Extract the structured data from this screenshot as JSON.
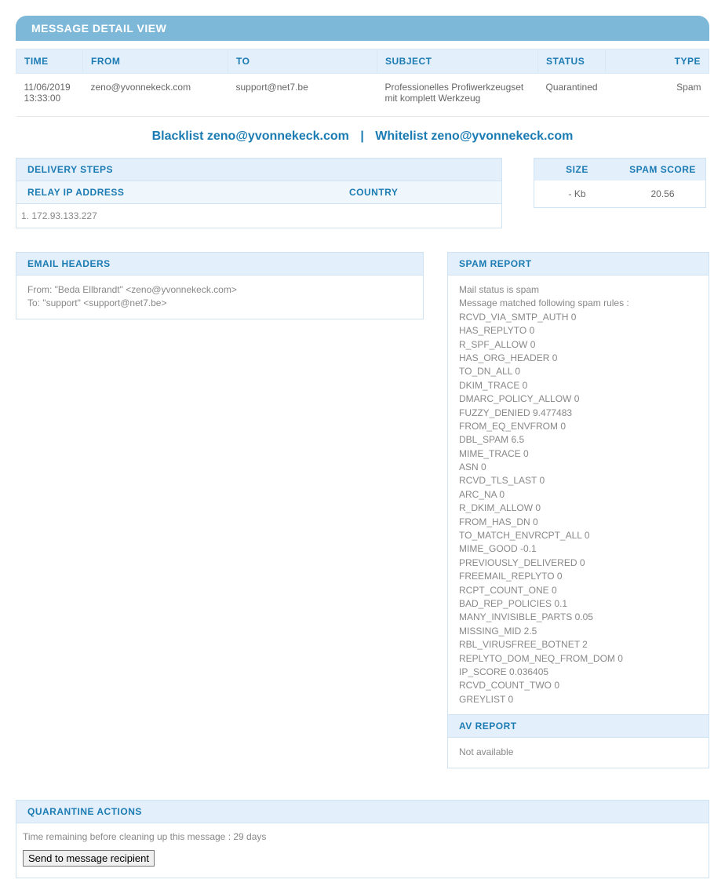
{
  "title": "MESSAGE DETAIL VIEW",
  "table": {
    "headers": {
      "time": "TIME",
      "from": "FROM",
      "to": "TO",
      "subject": "SUBJECT",
      "status": "STATUS",
      "type": "TYPE"
    },
    "row": {
      "time": "11/06/2019 13:33:00",
      "from": "zeno@yvonnekeck.com",
      "to": "support@net7.be",
      "subject": "Professionelles Profiwerkzeugset mit komplett Werkzeug",
      "status": "Quarantined",
      "type": "Spam"
    }
  },
  "bw": {
    "blacklist": "Blacklist zeno@yvonnekeck.com",
    "whitelist": "Whitelist zeno@yvonnekeck.com",
    "sep": "|"
  },
  "delivery": {
    "title": "DELIVERY STEPS",
    "relay_label": "RELAY IP ADDRESS",
    "country_label": "COUNTRY",
    "entry": "1. 172.93.133.227"
  },
  "score": {
    "size_label": "SIZE",
    "spam_label": "SPAM SCORE",
    "size_value": "- Kb",
    "spam_value": "20.56"
  },
  "headers": {
    "title": "EMAIL HEADERS",
    "from_line": "From: \"Beda Ellbrandt\" <zeno@yvonnekeck.com>",
    "to_line": "To: \"support\" <support@net7.be>"
  },
  "spam": {
    "title": "SPAM REPORT",
    "status": "Mail status is spam",
    "matched": "Message matched following spam rules :",
    "rules": [
      "RCVD_VIA_SMTP_AUTH   0",
      "HAS_REPLYTO   0",
      "R_SPF_ALLOW   0",
      "HAS_ORG_HEADER   0",
      "TO_DN_ALL   0",
      "DKIM_TRACE   0",
      "DMARC_POLICY_ALLOW   0",
      "FUZZY_DENIED   9.477483",
      "FROM_EQ_ENVFROM   0",
      "DBL_SPAM   6.5",
      "MIME_TRACE   0",
      "ASN   0",
      "RCVD_TLS_LAST   0",
      "ARC_NA   0",
      "R_DKIM_ALLOW   0",
      "FROM_HAS_DN   0",
      "TO_MATCH_ENVRCPT_ALL   0",
      "MIME_GOOD   -0.1",
      "PREVIOUSLY_DELIVERED   0",
      "FREEMAIL_REPLYTO   0",
      "RCPT_COUNT_ONE   0",
      "BAD_REP_POLICIES   0.1",
      "MANY_INVISIBLE_PARTS   0.05",
      "MISSING_MID   2.5",
      "RBL_VIRUSFREE_BOTNET   2",
      "REPLYTO_DOM_NEQ_FROM_DOM   0",
      "IP_SCORE   0.036405",
      "RCVD_COUNT_TWO   0",
      "GREYLIST   0"
    ]
  },
  "av": {
    "title": "AV REPORT",
    "body": "Not available"
  },
  "qa": {
    "title": "QUARANTINE ACTIONS",
    "remaining": "Time remaining before cleaning up this message : 29 days",
    "button": "Send to message recipient"
  }
}
